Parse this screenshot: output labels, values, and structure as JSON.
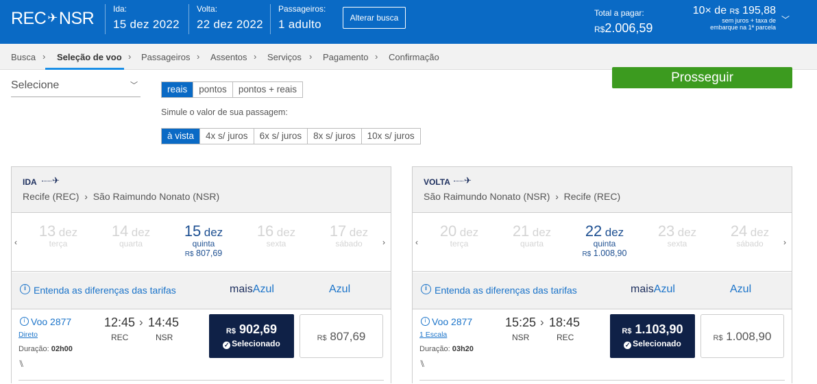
{
  "header": {
    "logo": {
      "from": "REC",
      "to": "NSR",
      "icon": "plane-icon"
    },
    "ida_label": "Ida:",
    "ida_value": "15 dez 2022",
    "volta_label": "Volta:",
    "volta_value": "22 dez 2022",
    "pass_label": "Passageiros:",
    "pass_value": "1 adulto",
    "alter_button": "Alterar busca",
    "total_label": "Total a pagar:",
    "total_currency": "R$",
    "total_value": "2.006,59",
    "installments": "10× de",
    "installment_currency": "R$",
    "installment_value": "195,88",
    "installment_note_1": "sem juros + taxa de",
    "installment_note_2": "embarque na 1ª parcela",
    "colors": {
      "brand": "#0a6ac5"
    }
  },
  "steps": [
    "Busca",
    "Seleção de voo",
    "Passageiros",
    "Assentos",
    "Serviços",
    "Pagamento",
    "Confirmação"
  ],
  "active_step": "Seleção de voo",
  "filter": {
    "select_value": "Selecione"
  },
  "payment_type": [
    "reais",
    "pontos",
    "pontos + reais"
  ],
  "simulate_label": "Simule o valor de sua passagem:",
  "installment_opts": [
    "à vista",
    "4x s/ juros",
    "6x s/ juros",
    "8x s/ juros",
    "10x s/ juros"
  ],
  "proceed_button": "Prosseguir",
  "fare_info": "Entenda as diferenças das tarifas",
  "fare_mais": "mais",
  "fare_azul": "Azul",
  "ida": {
    "dir": "IDA",
    "route_from": "Recife (REC)",
    "route_to": "São Raimundo Nonato (NSR)",
    "dates": [
      {
        "day": "13",
        "month": "dez",
        "weekday": "terça"
      },
      {
        "day": "14",
        "month": "dez",
        "weekday": "quarta"
      },
      {
        "day": "15",
        "month": "dez",
        "weekday": "quinta",
        "currency": "R$",
        "price": "807,69"
      },
      {
        "day": "16",
        "month": "dez",
        "weekday": "sexta"
      },
      {
        "day": "17",
        "month": "dez",
        "weekday": "sábado"
      }
    ],
    "flight": {
      "number": "Voo 2877",
      "type": "Direto",
      "duration_label": "Duração:",
      "duration": "02h00",
      "dep_time": "12:45",
      "arr_time": "14:45",
      "dep_apt": "REC",
      "arr_apt": "NSR",
      "price_sel_cur": "R$",
      "price_sel": "902,69",
      "selected": "Selecionado",
      "price_opt_cur": "R$",
      "price_opt": "807,69"
    }
  },
  "volta": {
    "dir": "VOLTA",
    "route_from": "São Raimundo Nonato (NSR)",
    "route_to": "Recife (REC)",
    "dates": [
      {
        "day": "20",
        "month": "dez",
        "weekday": "terça"
      },
      {
        "day": "21",
        "month": "dez",
        "weekday": "quarta"
      },
      {
        "day": "22",
        "month": "dez",
        "weekday": "quinta",
        "currency": "R$",
        "price": "1.008,90"
      },
      {
        "day": "23",
        "month": "dez",
        "weekday": "sexta"
      },
      {
        "day": "24",
        "month": "dez",
        "weekday": "sábado"
      }
    ],
    "flight": {
      "number": "Voo 2877",
      "type": "1 Escala",
      "duration_label": "Duração:",
      "duration": "03h20",
      "dep_time": "15:25",
      "arr_time": "18:45",
      "dep_apt": "NSR",
      "arr_apt": "REC",
      "price_sel_cur": "R$",
      "price_sel": "1.103,90",
      "selected": "Selecionado",
      "price_opt_cur": "R$",
      "price_opt": "1.008,90"
    }
  }
}
